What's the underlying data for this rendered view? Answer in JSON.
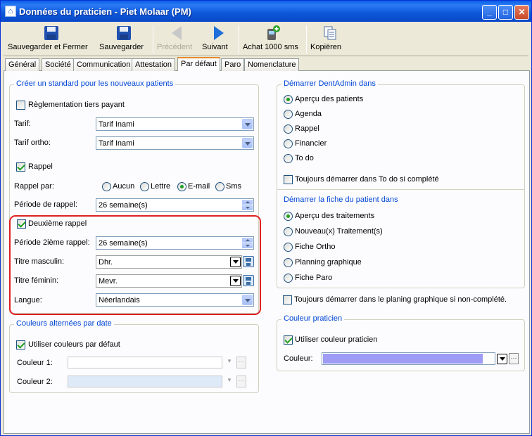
{
  "window": {
    "title": "Données du praticien - Piet Molaar (PM)",
    "title_icon": "app-icon"
  },
  "toolbar": {
    "save_close": "Sauvegarder et Fermer",
    "save": "Sauvegarder",
    "previous": "Précédent",
    "next": "Suivant",
    "buy_sms": "Achat 1000 sms",
    "copy": "Kopiëren"
  },
  "tabs": [
    "Général",
    "Société",
    "Communication",
    "Attestation",
    "Par défaut",
    "Paro",
    "Nomenclature"
  ],
  "active_tab": "Par défaut",
  "left": {
    "group1_title": "Créer un standard pour les nouveaux patients",
    "tiers_payant": "Règlementation tiers payant",
    "tarif_label": "Tarif:",
    "tarif_value": "Tarif Inami",
    "tarif_ortho_label": "Tarif ortho:",
    "tarif_ortho_value": "Tarif Inami",
    "rappel": "Rappel",
    "rappel_par_label": "Rappel par:",
    "rappel_options": [
      "Aucun",
      "Lettre",
      "E-mail",
      "Sms"
    ],
    "rappel_selected": "E-mail",
    "periode_label": "Période de rappel:",
    "periode_value": "26 semaine(s)",
    "deuxieme_rappel": "Deuxième rappel",
    "periode2_label": "Période 2ième rappel:",
    "periode2_value": "26 semaine(s)",
    "titre_m_label": "Titre masculin:",
    "titre_m_value": "Dhr.",
    "titre_f_label": "Titre féminin:",
    "titre_f_value": "Mevr.",
    "langue_label": "Langue:",
    "langue_value": "Néerlandais",
    "group2_title": "Couleurs alternées par date",
    "default_colors": "Utiliser couleurs par défaut",
    "couleur1_label": "Couleur 1:",
    "couleur2_label": "Couleur 2:"
  },
  "right": {
    "start_title": "Démarrer DentAdmin dans",
    "start_options": [
      "Aperçu des patients",
      "Agenda",
      "Rappel",
      "Financier",
      "To do"
    ],
    "start_selected": "Aperçu des patients",
    "todo_check": "Toujours démarrer dans To do si complété",
    "fiche_title": "Démarrer la fiche du patient dans",
    "fiche_options": [
      "Aperçu des traitements",
      "Nouveau(x) Traitement(s)",
      "Fiche Ortho",
      "Planning graphique",
      "Fiche Paro"
    ],
    "fiche_selected": "Aperçu des traitements",
    "planning_check": "Toujours démarrer dans le planing graphique si non-complété.",
    "color_title": "Couleur praticien",
    "use_color": "Utiliser couleur praticien",
    "couleur_label": "Couleur:",
    "couleur_value": "#9e9cf5"
  }
}
